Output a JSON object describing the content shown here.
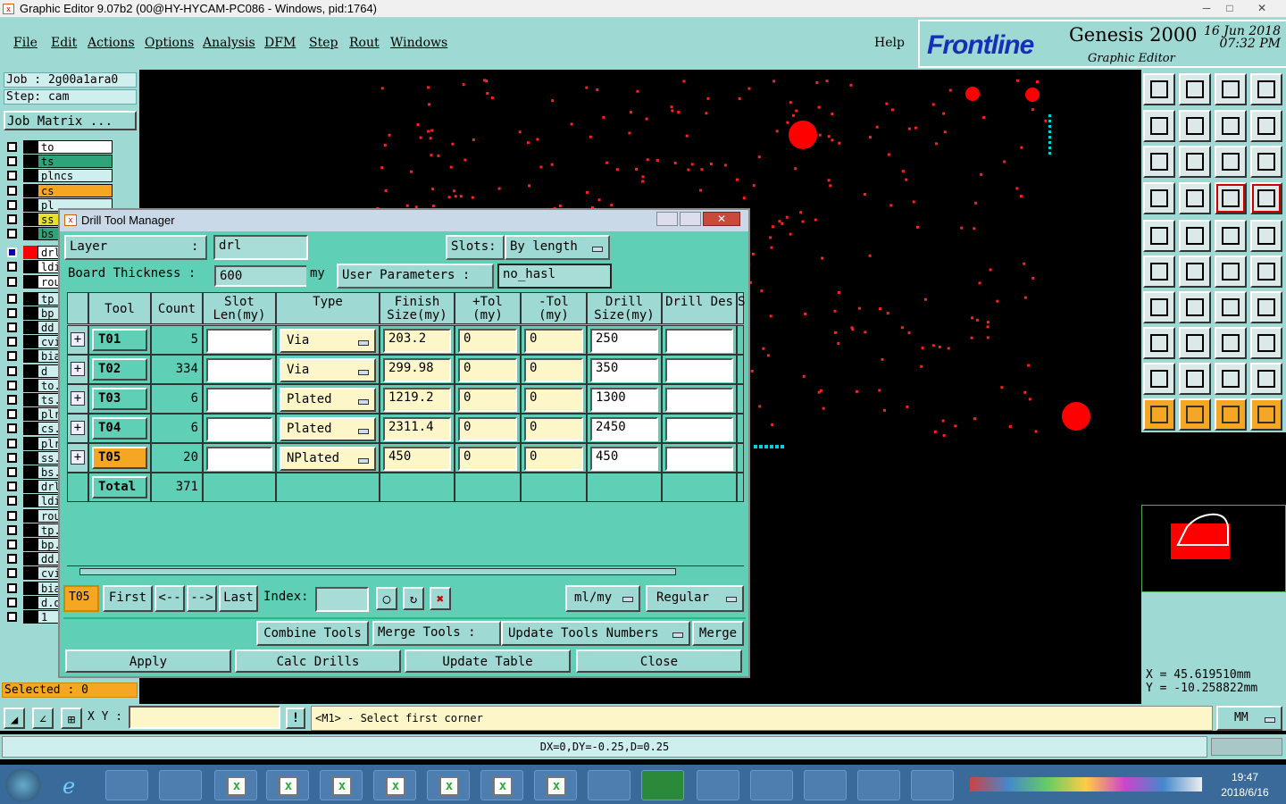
{
  "window": {
    "title": "Graphic Editor 9.07b2 (00@HY-HYCAM-PC086 - Windows, pid:1764)"
  },
  "menu": {
    "items": [
      "File",
      "Edit",
      "Actions",
      "Options",
      "Analysis",
      "DFM",
      "Step",
      "Rout",
      "Windows"
    ],
    "help": "Help"
  },
  "brand": {
    "logo": "Frontline",
    "product": "Genesis 2000",
    "date": "16 Jun 2018",
    "time": "07:32 PM",
    "subtitle": "Graphic Editor"
  },
  "left": {
    "job": "Job : 2g00a1ara0",
    "step": "Step: cam",
    "matrix": "Job Matrix ...",
    "layers": [
      {
        "name": "to",
        "color": "#ffffff"
      },
      {
        "name": "ts",
        "color": "#2fa37a"
      },
      {
        "name": "plncs",
        "color": "#cfeeee"
      },
      {
        "name": "cs",
        "color": "#f5a623"
      },
      {
        "name": "pl",
        "color": "#cfeeee"
      },
      {
        "name": "ss",
        "color": "#e8e030"
      },
      {
        "name": "bs",
        "color": "#2fa37a"
      },
      {
        "name": "drl",
        "color": "#ffffff"
      },
      {
        "name": "ldi",
        "color": "#ffffff"
      },
      {
        "name": "rou",
        "color": "#ffffff"
      },
      {
        "name": "tp",
        "color": "#cfeeee"
      },
      {
        "name": "bp",
        "color": "#cfeeee"
      },
      {
        "name": "dd",
        "color": "#cfeeee"
      },
      {
        "name": "cvi",
        "color": "#cfeeee"
      },
      {
        "name": "bia",
        "color": "#cfeeee"
      },
      {
        "name": "d",
        "color": "#cfeeee"
      },
      {
        "name": "to.",
        "color": "#cfeeee"
      },
      {
        "name": "ts.",
        "color": "#cfeeee"
      },
      {
        "name": "plr",
        "color": "#cfeeee"
      },
      {
        "name": "cs.",
        "color": "#cfeeee"
      },
      {
        "name": "plr",
        "color": "#cfeeee"
      },
      {
        "name": "ss.",
        "color": "#cfeeee"
      },
      {
        "name": "bs.",
        "color": "#cfeeee"
      },
      {
        "name": "drl",
        "color": "#cfeeee"
      },
      {
        "name": "ldi",
        "color": "#cfeeee"
      },
      {
        "name": "rou",
        "color": "#cfeeee"
      },
      {
        "name": "tp.",
        "color": "#cfeeee"
      },
      {
        "name": "bp.",
        "color": "#cfeeee"
      },
      {
        "name": "dd.",
        "color": "#cfeeee"
      },
      {
        "name": "cvi",
        "color": "#cfeeee"
      },
      {
        "name": "bia",
        "color": "#cfeeee"
      },
      {
        "name": "d.d",
        "color": "#cfeeee"
      },
      {
        "name": "1",
        "color": "#cfeeee"
      }
    ],
    "selected": "Selected : 0"
  },
  "dialog": {
    "title": "Drill Tool Manager",
    "layer_label": "Layer",
    "layer_colon": ":",
    "layer_value": "drl",
    "slots_label": "Slots:",
    "slots_value": "By length",
    "thickness_label": "Board Thickness :",
    "thickness_value": "600",
    "thickness_unit": "my",
    "user_params_label": "User Parameters :",
    "user_params_value": "no_hasl",
    "columns": [
      "Tool",
      "Count",
      "Slot Len(my)",
      "Type",
      "Finish Size(my)",
      "+Tol (my)",
      "-Tol (my)",
      "Drill Size(my)",
      "Drill Des",
      "S"
    ],
    "rows": [
      {
        "tool": "T01",
        "count": "5",
        "slot": "",
        "type": "Via",
        "finish": "203.2",
        "ptol": "0",
        "ntol": "0",
        "drill": "250",
        "des": ""
      },
      {
        "tool": "T02",
        "count": "334",
        "slot": "",
        "type": "Via",
        "finish": "299.98",
        "ptol": "0",
        "ntol": "0",
        "drill": "350",
        "des": ""
      },
      {
        "tool": "T03",
        "count": "6",
        "slot": "",
        "type": "Plated",
        "finish": "1219.2",
        "ptol": "0",
        "ntol": "0",
        "drill": "1300",
        "des": ""
      },
      {
        "tool": "T04",
        "count": "6",
        "slot": "",
        "type": "Plated",
        "finish": "2311.4",
        "ptol": "0",
        "ntol": "0",
        "drill": "2450",
        "des": ""
      },
      {
        "tool": "T05",
        "count": "20",
        "slot": "",
        "type": "NPlated",
        "finish": "450",
        "ptol": "0",
        "ntol": "0",
        "drill": "450",
        "des": ""
      }
    ],
    "total_label": "Total",
    "total_count": "371",
    "nav": {
      "current": "T05",
      "first": "First",
      "prev": "<--",
      "next": "-->",
      "last": "Last",
      "index_label": "Index:",
      "units": "ml/my",
      "mode": "Regular"
    },
    "combine": "Combine Tools",
    "merge_label": "Merge Tools :",
    "merge_option": "Update Tools Numbers",
    "merge": "Merge",
    "apply": "Apply",
    "calc": "Calc Drills",
    "update": "Update Table",
    "close": "Close"
  },
  "coords": {
    "x": "X = 45.619510mm",
    "y": "Y = -10.258822mm"
  },
  "bottom": {
    "xy_label": "X Y :",
    "prompt": "<M1> - Select first corner",
    "units": "MM"
  },
  "status": {
    "text": "DX=0,DY=-0.25,D=0.25"
  },
  "taskbar": {
    "time": "19:47",
    "date": "2018/6/16"
  }
}
